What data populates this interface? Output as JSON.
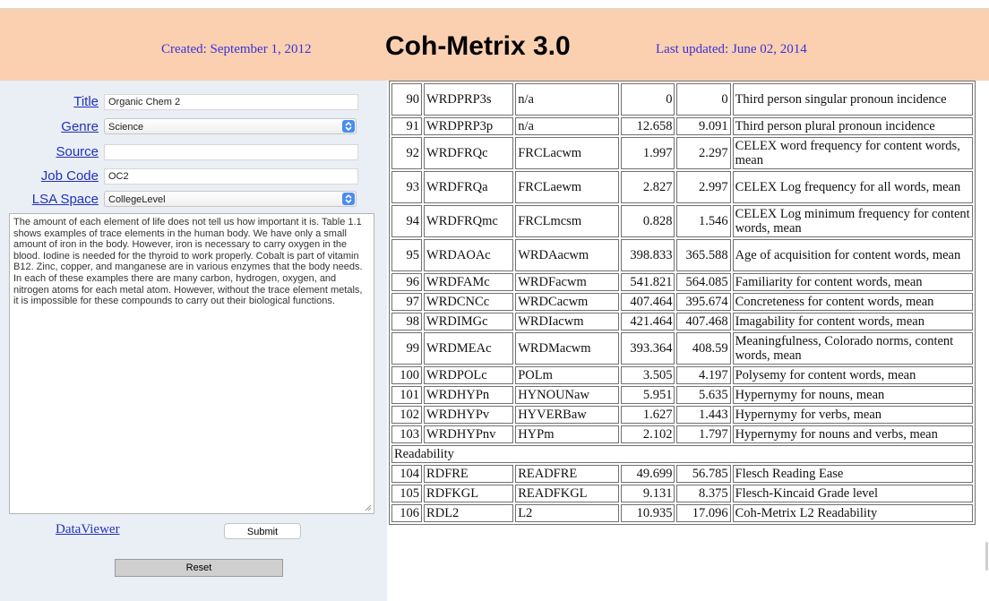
{
  "header": {
    "created": "Created: September 1, 2012",
    "title": "Coh-Metrix 3.0",
    "updated": "Last updated: June 02, 2014"
  },
  "form": {
    "title_label": "Title",
    "title_value": "Organic Chem 2",
    "genre_label": "Genre",
    "genre_value": "Science",
    "source_label": "Source",
    "source_value": "",
    "jobcode_label": "Job Code",
    "jobcode_value": "OC2",
    "lsa_label": "LSA Space",
    "lsa_value": "CollegeLevel",
    "text": "The amount of each element of life does not tell us how important it is. Table 1.1 shows examples of trace elements in the human body. We have only a small amount of iron in the body. However, iron is necessary to carry oxygen in the blood. Iodine is needed for the thyroid to work properly. Cobalt is part of vitamin B12. Zinc, copper, and manganese are in various enzymes that the body needs. In each of these examples there are many carbon, hydrogen, oxygen, and nitrogen atoms for each metal atom. However, without the trace element metals, it is impossible for these compounds to carry out their biological functions.",
    "dataviewer_label": "DataViewer",
    "submit_label": "Submit",
    "reset_label": "Reset"
  },
  "results": {
    "rows": [
      {
        "n": "90",
        "label": "WRDPRP3s",
        "lsa": "n/a",
        "v1": "0",
        "v2": "0",
        "desc": "Third person singular pronoun incidence",
        "h": 36
      },
      {
        "n": "91",
        "label": "WRDPRP3p",
        "lsa": "n/a",
        "v1": "12.658",
        "v2": "9.091",
        "desc": "Third person plural pronoun incidence",
        "h": 20
      },
      {
        "n": "92",
        "label": "WRDFRQc",
        "lsa": "FRCLacwm",
        "v1": "1.997",
        "v2": "2.297",
        "desc": "CELEX word frequency for content words, mean",
        "h": 36
      },
      {
        "n": "93",
        "label": "WRDFRQa",
        "lsa": "FRCLaewm",
        "v1": "2.827",
        "v2": "2.997",
        "desc": "CELEX Log frequency for all words, mean",
        "h": 36
      },
      {
        "n": "94",
        "label": "WRDFRQmc",
        "lsa": "FRCLmcsm",
        "v1": "0.828",
        "v2": "1.546",
        "desc": "CELEX Log minimum frequency for content words, mean",
        "h": 36
      },
      {
        "n": "95",
        "label": "WRDAOAc",
        "lsa": "WRDAacwm",
        "v1": "398.833",
        "v2": "365.588",
        "desc": "Age of acquisition for content words, mean",
        "h": 36
      },
      {
        "n": "96",
        "label": "WRDFAMc",
        "lsa": "WRDFacwm",
        "v1": "541.821",
        "v2": "564.085",
        "desc": "Familiarity for content words, mean",
        "h": 20
      },
      {
        "n": "97",
        "label": "WRDCNCc",
        "lsa": "WRDCacwm",
        "v1": "407.464",
        "v2": "395.674",
        "desc": "Concreteness for content words, mean",
        "h": 20
      },
      {
        "n": "98",
        "label": "WRDIMGc",
        "lsa": "WRDIacwm",
        "v1": "421.464",
        "v2": "407.468",
        "desc": "Imagability for content words, mean",
        "h": 20
      },
      {
        "n": "99",
        "label": "WRDMEAc",
        "lsa": "WRDMacwm",
        "v1": "393.364",
        "v2": "408.59",
        "desc": "Meaningfulness, Colorado norms, content words, mean",
        "h": 36
      },
      {
        "n": "100",
        "label": "WRDPOLc",
        "lsa": "POLm",
        "v1": "3.505",
        "v2": "4.197",
        "desc": "Polysemy for content words, mean",
        "h": 20
      },
      {
        "n": "101",
        "label": "WRDHYPn",
        "lsa": "HYNOUNaw",
        "v1": "5.951",
        "v2": "5.635",
        "desc": "Hypernymy for nouns, mean",
        "h": 20
      },
      {
        "n": "102",
        "label": "WRDHYPv",
        "lsa": "HYVERBaw",
        "v1": "1.627",
        "v2": "1.443",
        "desc": "Hypernymy for verbs, mean",
        "h": 20
      },
      {
        "n": "103",
        "label": "WRDHYPnv",
        "lsa": "HYPm",
        "v1": "2.102",
        "v2": "1.797",
        "desc": "Hypernymy for nouns and verbs, mean",
        "h": 20
      }
    ],
    "section": "Readability",
    "rows2": [
      {
        "n": "104",
        "label": "RDFRE",
        "lsa": "READFRE",
        "v1": "49.699",
        "v2": "56.785",
        "desc": "Flesch Reading Ease",
        "h": 20
      },
      {
        "n": "105",
        "label": "RDFKGL",
        "lsa": "READFKGL",
        "v1": "9.131",
        "v2": "8.375",
        "desc": "Flesch-Kincaid Grade level",
        "h": 20
      },
      {
        "n": "106",
        "label": "RDL2",
        "lsa": "L2",
        "v1": "10.935",
        "v2": "17.096",
        "desc": "Coh-Metrix L2 Readability",
        "h": 20
      }
    ]
  },
  "colors": {
    "header_bg": "#fbd0b0",
    "link": "#1f32b8",
    "header_text": "#3a32d8",
    "select_button": "#4a8cf0"
  }
}
